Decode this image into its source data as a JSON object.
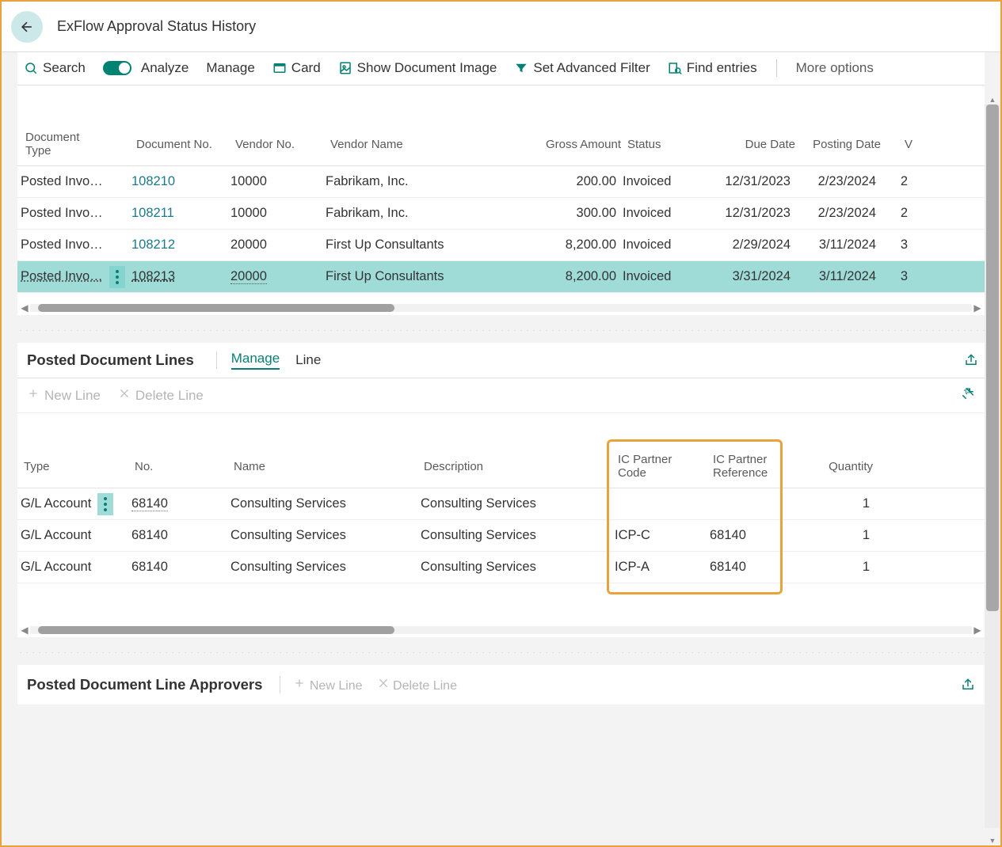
{
  "header": {
    "title": "ExFlow Approval Status History"
  },
  "toolbar": {
    "search": "Search",
    "analyze": "Analyze",
    "manage": "Manage",
    "card": "Card",
    "show_doc_image": "Show Document Image",
    "set_adv_filter": "Set Advanced Filter",
    "find_entries": "Find entries",
    "more_options": "More options"
  },
  "docs": {
    "headers": {
      "doc_type_1": "Document",
      "doc_type_2": "Type",
      "doc_no": "Document No.",
      "vendor_no": "Vendor No.",
      "vendor_name": "Vendor Name",
      "gross_amount": "Gross Amount",
      "status": "Status",
      "due_date": "Due Date",
      "posting_date": "Posting Date",
      "vat_partial": "V"
    },
    "rows": [
      {
        "doc_type": "Posted Invo…",
        "doc_no": "108210",
        "vendor_no": "10000",
        "vendor_name": "Fabrikam, Inc.",
        "gross_amount": "200.00",
        "status": "Invoiced",
        "due_date": "12/31/2023",
        "posting_date": "2/23/2024",
        "vp": "2"
      },
      {
        "doc_type": "Posted Invo…",
        "doc_no": "108211",
        "vendor_no": "10000",
        "vendor_name": "Fabrikam, Inc.",
        "gross_amount": "300.00",
        "status": "Invoiced",
        "due_date": "12/31/2023",
        "posting_date": "2/23/2024",
        "vp": "2"
      },
      {
        "doc_type": "Posted Invo…",
        "doc_no": "108212",
        "vendor_no": "20000",
        "vendor_name": "First Up Consultants",
        "gross_amount": "8,200.00",
        "status": "Invoiced",
        "due_date": "2/29/2024",
        "posting_date": "3/11/2024",
        "vp": "3"
      },
      {
        "doc_type": "Posted Invo…",
        "doc_no": "108213",
        "vendor_no": "20000",
        "vendor_name": "First Up Consultants",
        "gross_amount": "8,200.00",
        "status": "Invoiced",
        "due_date": "3/31/2024",
        "posting_date": "3/11/2024",
        "vp": "3"
      }
    ]
  },
  "lines_section": {
    "title": "Posted Document Lines",
    "tabs": {
      "manage": "Manage",
      "line": "Line"
    },
    "actions": {
      "new_line": "New Line",
      "delete_line": "Delete Line"
    }
  },
  "lines": {
    "headers": {
      "type": "Type",
      "no": "No.",
      "name": "Name",
      "description": "Description",
      "ic_code_1": "IC Partner",
      "ic_code_2": "Code",
      "ic_ref_1": "IC Partner",
      "ic_ref_2": "Reference",
      "quantity": "Quantity"
    },
    "rows": [
      {
        "type": "G/L Account",
        "no": "68140",
        "name": "Consulting Services",
        "description": "Consulting Services",
        "ic_code": "",
        "ic_ref": "",
        "quantity": "1"
      },
      {
        "type": "G/L Account",
        "no": "68140",
        "name": "Consulting Services",
        "description": "Consulting Services",
        "ic_code": "ICP-C",
        "ic_ref": "68140",
        "quantity": "1"
      },
      {
        "type": "G/L Account",
        "no": "68140",
        "name": "Consulting Services",
        "description": "Consulting Services",
        "ic_code": "ICP-A",
        "ic_ref": "68140",
        "quantity": "1"
      }
    ]
  },
  "approvers_section": {
    "title": "Posted Document Line Approvers",
    "new_line": "New Line",
    "delete_line": "Delete Line"
  }
}
